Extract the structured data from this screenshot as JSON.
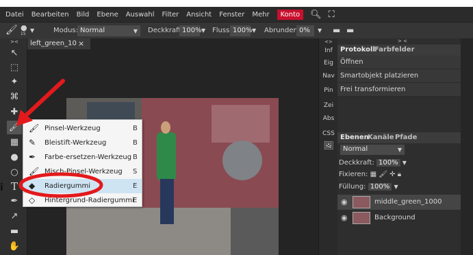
{
  "menu": {
    "items": [
      "Datei",
      "Bearbeiten",
      "Bild",
      "Ebene",
      "Auswahl",
      "Filter",
      "Ansicht",
      "Fenster",
      "Mehr"
    ],
    "account": "Konto",
    "icons": [
      "search-icon",
      "fullscreen-icon"
    ]
  },
  "options": {
    "brush_size": "15",
    "mode_label": "Modus:",
    "mode_value": "Normal",
    "opacity_label": "Deckkraft:",
    "opacity_value": "100%",
    "flow_label": "Fluss:",
    "flow_value": "100%",
    "smooth_label": "Abrunden:",
    "smooth_value": "0%"
  },
  "document": {
    "tab_title": "left_green_10",
    "tab_close": "×"
  },
  "mini_panel": {
    "collapse": "<>",
    "items": [
      "Inf",
      "Eig",
      "Nav",
      "Pin",
      "Zei",
      "Abs",
      "CSS"
    ]
  },
  "history_panel": {
    "collapse": "> <",
    "tabs": [
      "Protokoll",
      "Farbfelder"
    ],
    "entries": [
      "Öffnen",
      "Smartobjekt platzieren",
      "Frei transformieren"
    ]
  },
  "layers_panel": {
    "tabs": [
      "Ebenen",
      "Kanäle",
      "Pfade"
    ],
    "blend_mode": "Normal",
    "opacity_label": "Deckkraft:",
    "opacity_value": "100%",
    "lock_label": "Fixieren:",
    "fill_label": "Füllung:",
    "fill_value": "100%",
    "layers": [
      {
        "name": "middle_green_1000",
        "selected": true
      },
      {
        "name": "Background",
        "selected": false
      }
    ]
  },
  "flyout": {
    "items": [
      {
        "label": "Pinsel-Werkzeug",
        "key": "B",
        "icon": "brush-icon"
      },
      {
        "label": "Bleistift-Werkzeug",
        "key": "B",
        "icon": "pencil-icon"
      },
      {
        "label": "Farbe-ersetzen-Werkzeug",
        "key": "B",
        "icon": "color-replace-icon"
      },
      {
        "label": "Misch-Pinsel-Werkzeug",
        "key": "S",
        "icon": "mixer-brush-icon"
      },
      {
        "label": "Radiergummi",
        "key": "E",
        "icon": "eraser-icon",
        "highlighted": true
      },
      {
        "label": "Hintergrund-Radiergummi",
        "key": "E",
        "icon": "background-eraser-icon"
      }
    ]
  },
  "edge_label": "i",
  "colors": {
    "annotation_red": "#e3191c",
    "highlight": "#cfe4f3",
    "account_red": "#c8102e"
  }
}
